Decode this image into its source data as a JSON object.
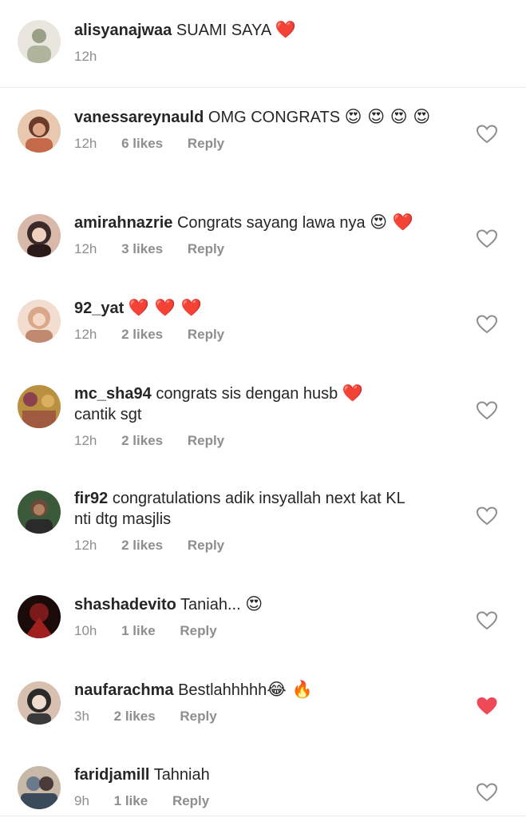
{
  "comments": [
    {
      "username": "alisyanajwaa",
      "text": "SUAMI SAYA",
      "emojis": "❤️",
      "time": "12h",
      "likes": "",
      "reply": "",
      "liked": false,
      "avatar_colors": [
        "#9a9f88",
        "#e8e6df"
      ]
    },
    {
      "username": "vanessareynauld",
      "text": "OMG CONGRATS",
      "emojis": "😍 😍 😍 😍",
      "time": "12h",
      "likes": "6 likes",
      "reply": "Reply",
      "liked": false,
      "avatar_colors": [
        "#c46a4a",
        "#6a3a2a"
      ]
    },
    {
      "username": "amirahnazrie",
      "text": "Congrats sayang lawa nya",
      "emojis": "😍 ❤️",
      "time": "12h",
      "likes": "3 likes",
      "reply": "Reply",
      "liked": false,
      "avatar_colors": [
        "#3a2a2a",
        "#d8b8a8"
      ]
    },
    {
      "username": "92_yat",
      "text": "",
      "emojis": "❤️ ❤️ ❤️",
      "time": "12h",
      "likes": "2 likes",
      "reply": "Reply",
      "liked": false,
      "avatar_colors": [
        "#d9a78a",
        "#f2ddd0"
      ]
    },
    {
      "username": "mc_sha94",
      "text": "congrats sis dengan husb",
      "emojis": "❤️",
      "text2": "cantik sgt",
      "time": "12h",
      "likes": "2 likes",
      "reply": "Reply",
      "liked": false,
      "avatar_colors": [
        "#b89040",
        "#8a4050"
      ]
    },
    {
      "username": "fir92",
      "text": "congratulations adik insyallah next kat KL",
      "text2": "nti dtg masjlis",
      "time": "12h",
      "likes": "2 likes",
      "reply": "Reply",
      "liked": false,
      "avatar_colors": [
        "#3a5a3a",
        "#6a4a3a"
      ]
    },
    {
      "username": "shashadevito",
      "text": "Taniah...",
      "emojis": "😍",
      "time": "10h",
      "likes": "1 like",
      "reply": "Reply",
      "liked": false,
      "avatar_colors": [
        "#7a1a1a",
        "#1a0a0a"
      ]
    },
    {
      "username": "naufarachma",
      "text": "Bestlahhhhh",
      "emojis": "😂 🔥",
      "time": "3h",
      "likes": "2 likes",
      "reply": "Reply",
      "liked": true,
      "avatar_colors": [
        "#2a2a2a",
        "#d8c0b0"
      ]
    },
    {
      "username": "faridjamill",
      "text": "Tahniah",
      "emojis": "",
      "time": "9h",
      "likes": "1 like",
      "reply": "Reply",
      "liked": false,
      "avatar_colors": [
        "#6a7a8a",
        "#c8b8a8"
      ]
    }
  ],
  "colors": {
    "liked_heart": "#ed4956",
    "heart_outline": "#8e8e8e"
  }
}
